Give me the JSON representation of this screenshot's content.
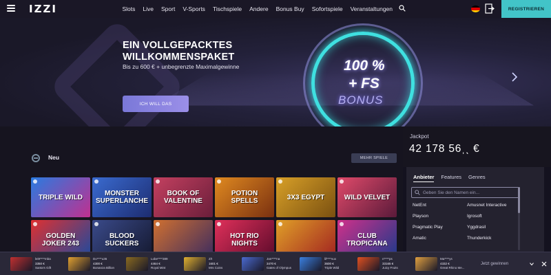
{
  "header": {
    "logo": "IZZI",
    "nav": [
      "Slots",
      "Live",
      "Sport",
      "V-Sports",
      "Tischspiele",
      "Andere",
      "Bonus Buy",
      "Sofortspiele",
      "Veranstaltungen"
    ],
    "register_label": "REGISTRIEREN"
  },
  "hero": {
    "title": "EIN VOLLGEPACKTES WILLKOMMENSPAKET",
    "subtitle": "Bis zu 600 € + unbegrenzte Maximalgewinne",
    "cta": "ICH WILL DAS",
    "badge_line1": "100 %",
    "badge_line2": "+ FS",
    "badge_line3": "BONUS"
  },
  "games": {
    "section_label": "Neu",
    "more_label": "MEHR SPIELE",
    "tiles": [
      {
        "name": "TRIPLE WILD",
        "color1": "#2a7be0",
        "color2": "#c03090"
      },
      {
        "name": "MONSTER SUPERLANCHE",
        "color1": "#3a6bd0",
        "color2": "#1d2c70"
      },
      {
        "name": "BOOK OF VALENTINE",
        "color1": "#c44060",
        "color2": "#6a1e3a"
      },
      {
        "name": "POTION SPELLS",
        "color1": "#e08a20",
        "color2": "#7a3010"
      },
      {
        "name": "3X3 EGYPT",
        "color1": "#d8a028",
        "color2": "#7a5010"
      },
      {
        "name": "WILD VELVET",
        "color1": "#e04a6a",
        "color2": "#5a1a3a"
      },
      {
        "name": "GOLDEN JOKER 243",
        "color1": "#e03030",
        "color2": "#1a4aa0"
      },
      {
        "name": "BLOOD SUCKERS",
        "color1": "#3a4a8a",
        "color2": "#14182e"
      },
      {
        "name": "",
        "color1": "#d07030",
        "color2": "#3a2a60"
      },
      {
        "name": "HOT RIO NIGHTS",
        "color1": "#e0305a",
        "color2": "#5a0a2a"
      },
      {
        "name": "",
        "color1": "#e0a028",
        "color2": "#a02020"
      },
      {
        "name": "CLUB TROPICANA",
        "color1": "#d0308a",
        "color2": "#1a3a8a"
      }
    ]
  },
  "jackpot": {
    "label": "Jackpot",
    "value": "42 178 56ˌˎ €"
  },
  "providers": {
    "tabs": [
      "Anbieter",
      "Features",
      "Genres"
    ],
    "search_placeholder": "Geben Sie den Namen ein...",
    "items": [
      "NetEnt",
      "Amusnet Interactive",
      "Playson",
      "Igrosoft",
      "Pragmatic Play",
      "Yggdrasil",
      "Amatic",
      "Thunderkick"
    ]
  },
  "ticker": {
    "label": "Jetzt gewinnen",
    "wins": [
      {
        "user": "lei9****mba",
        "amount": "3350 €",
        "game": "Santa's Gift",
        "color": "#c03030"
      },
      {
        "user": "Do****u36",
        "amount": "4300 €",
        "game": "Bonanza Billion",
        "color": "#e0a030"
      },
      {
        "user": "Lobe****389",
        "amount": "4464 €",
        "game": "Royal Mint",
        "color": "#8a6a20"
      },
      {
        "user": "Z/I",
        "amount": "1601 €",
        "game": "Mrs Coins",
        "color": "#e0b030"
      },
      {
        "user": "Jan****na",
        "amount": "3470 €",
        "game": "Gates of Olympus",
        "color": "#4a6ad0"
      },
      {
        "user": "lil****vux",
        "amount": "3600 €",
        "game": "Triple Wild",
        "color": "#3a80e0"
      },
      {
        "user": "rr****ps",
        "amount": "33165 €",
        "game": "Juicy Fruits",
        "color": "#e05020"
      },
      {
        "user": "Ma****ys",
        "amount": "4332 €",
        "game": "Great Rhino Me...",
        "color": "#e0a040"
      }
    ]
  },
  "colors": {
    "accent": "#42c4c8",
    "cta": "#8a84e0",
    "background": "#16141f"
  }
}
